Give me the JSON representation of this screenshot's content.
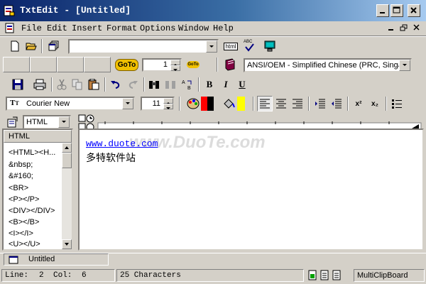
{
  "window": {
    "title": "TxtEdit - [Untitled]"
  },
  "menu": [
    "File",
    "Edit",
    "Insert",
    "Format",
    "Options",
    "Window",
    "Help"
  ],
  "toolbar1": {
    "url_value": "",
    "html_label": "html",
    "spell_label": "ABC",
    "goto_label": "GoTo",
    "line_value": "1",
    "goto2_label": "GoTo",
    "encoding": "ANSI/OEM - Simplified Chinese (PRC, Singapore)"
  },
  "toolbar3": {
    "font": "Courier New",
    "size": "11",
    "bold": "B",
    "italic": "I",
    "underline": "U",
    "superscript": "x²",
    "subscript": "x₂"
  },
  "tag_panel": {
    "mode": "HTML",
    "header": "HTML",
    "items": [
      "<HTML><H...",
      "&nbsp;",
      "&#160;",
      "<BR>",
      "<P></P>",
      "<DIV></DIV>",
      "<B></B>",
      "<I></I>",
      "<U></U>"
    ]
  },
  "editor": {
    "line1": "www.duote.com",
    "line2": "多特软件站"
  },
  "watermark": "www.DuoTe.com",
  "tab": {
    "label": "Untitled"
  },
  "status": {
    "line_label": "Line:",
    "line": "2",
    "col_label": "Col:",
    "col": "6",
    "chars": "25 Characters",
    "clipboard": "MultiClipBoard"
  },
  "colors": {
    "titlebar": "#0a246a",
    "text_color": "#ff0000",
    "highlight": "#ffff00",
    "link": "#0000ff"
  }
}
